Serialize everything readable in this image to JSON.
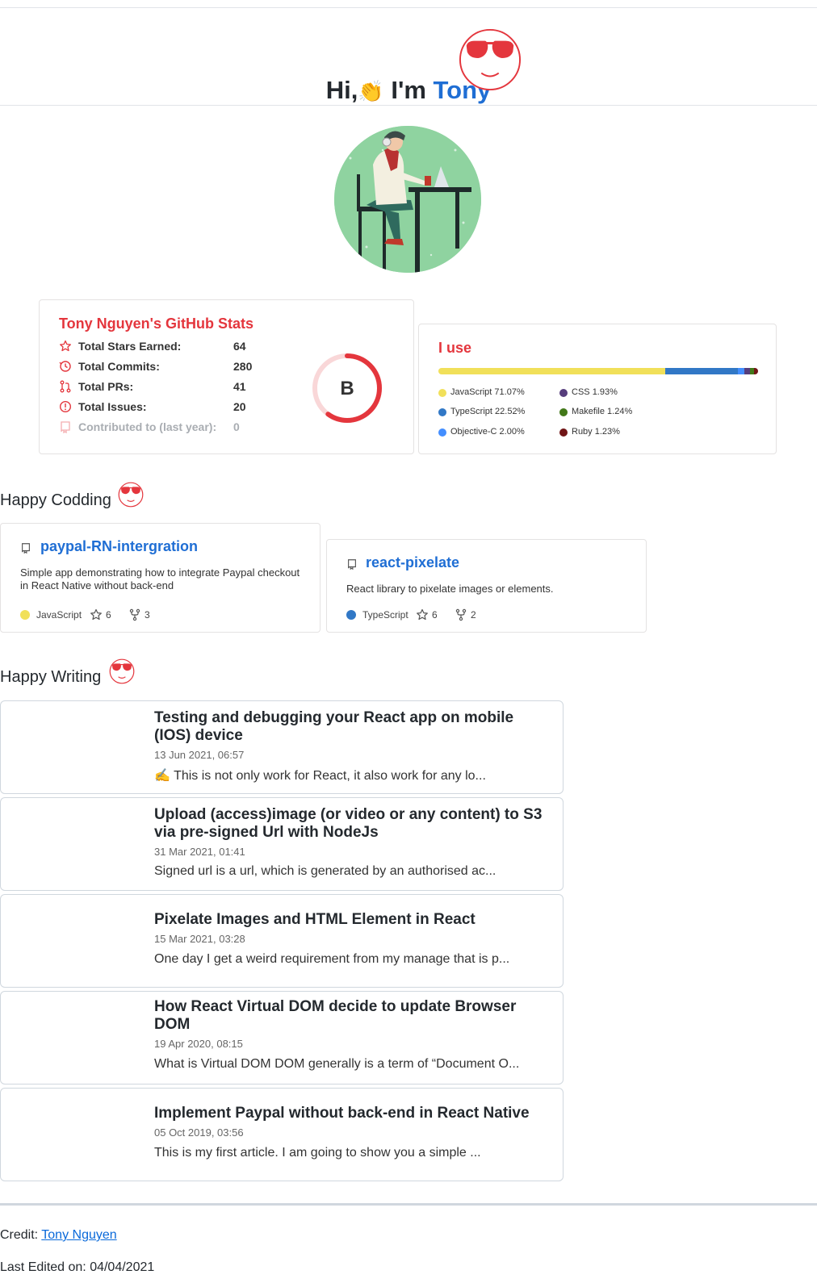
{
  "header": {
    "greeting": "Hi,",
    "wave_emoji": "👏",
    "intro": " I'm ",
    "name": "Tony"
  },
  "stats": {
    "title": "Tony Nguyen's GitHub Stats",
    "rows": [
      {
        "label": "Total Stars Earned:",
        "value": "64",
        "icon": "star-icon"
      },
      {
        "label": "Total Commits:",
        "value": "280",
        "icon": "history-icon"
      },
      {
        "label": "Total PRs:",
        "value": "41",
        "icon": "pull-request-icon"
      },
      {
        "label": "Total Issues:",
        "value": "20",
        "icon": "issue-icon"
      },
      {
        "label": "Contributed to (last year):",
        "value": "0",
        "icon": "repo-icon"
      }
    ],
    "rank": "B",
    "rank_progress": 0.6
  },
  "languages": {
    "title": "I use",
    "items": [
      {
        "name": "JavaScript",
        "percent": "71.07%",
        "value": 71.07,
        "color": "#f1e05a"
      },
      {
        "name": "TypeScript",
        "percent": "22.52%",
        "value": 22.52,
        "color": "#3178c6"
      },
      {
        "name": "Objective-C",
        "percent": "2.00%",
        "value": 2.0,
        "color": "#438eff"
      },
      {
        "name": "CSS",
        "percent": "1.93%",
        "value": 1.93,
        "color": "#563d7c"
      },
      {
        "name": "Makefile",
        "percent": "1.24%",
        "value": 1.24,
        "color": "#427819"
      },
      {
        "name": "Ruby",
        "percent": "1.23%",
        "value": 1.23,
        "color": "#701516"
      }
    ]
  },
  "coding": {
    "title": "Happy Codding",
    "repos": [
      {
        "name": "paypal-RN-intergration",
        "description": "Simple app demonstrating how to integrate Paypal checkout in React Native without back-end",
        "language": "JavaScript",
        "language_color": "#f1e05a",
        "stars": "6",
        "forks": "3"
      },
      {
        "name": "react-pixelate",
        "description": "React library to pixelate images or elements.",
        "language": "TypeScript",
        "language_color": "#3178c6",
        "stars": "6",
        "forks": "2"
      }
    ]
  },
  "writing": {
    "title": "Happy Writing",
    "articles": [
      {
        "title": "Testing and debugging your React app on mobile (IOS) device",
        "date": "13 Jun 2021, 06:57",
        "excerpt": "✍️ This is not only work for React, it also work for any lo..."
      },
      {
        "title": "Upload (access)image (or video or any content) to S3 via pre-signed Url with NodeJs",
        "date": "31 Mar 2021, 01:41",
        "excerpt": "Signed url is a url, which is generated by an authorised ac..."
      },
      {
        "title": "Pixelate Images and HTML Element in React",
        "date": "15 Mar 2021, 03:28",
        "excerpt": "One day I get a weird requirement from my manage that is p..."
      },
      {
        "title": "How React Virtual DOM decide to update Browser DOM",
        "date": "19 Apr 2020, 08:15",
        "excerpt": "What is Virtual DOM DOM generally is a term of “Document O..."
      },
      {
        "title": "Implement Paypal without back-end in React Native",
        "date": "05 Oct 2019, 03:56",
        "excerpt": "This is my first article. I am going to show you a simple ..."
      }
    ]
  },
  "footer": {
    "credit_label": "Credit: ",
    "credit_link": "Tony Nguyen",
    "last_edited": "Last Edited on: 04/04/2021"
  }
}
